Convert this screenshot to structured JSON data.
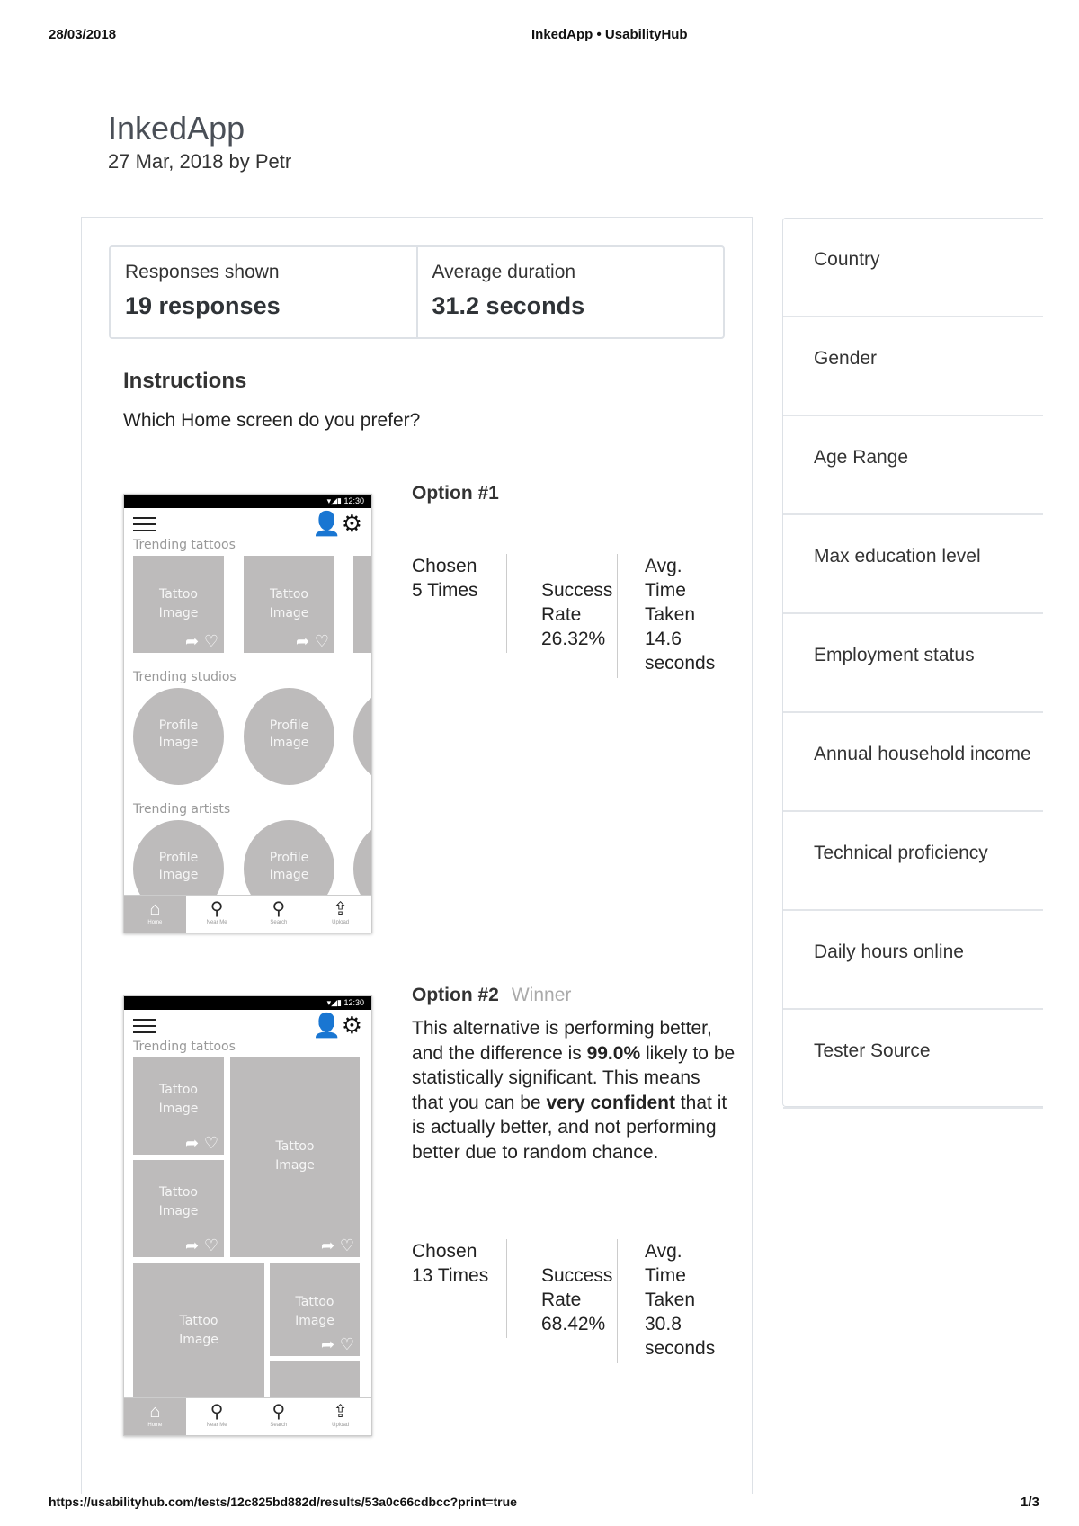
{
  "print_header": {
    "date": "28/03/2018",
    "title": "InkedApp • UsabilityHub"
  },
  "print_footer": {
    "url": "https://usabilityhub.com/tests/12c825bd882d/results/53a0c66cdbcc?print=true",
    "page": "1/3"
  },
  "test": {
    "title": "InkedApp",
    "subtitle": "27 Mar, 2018 by Petr"
  },
  "stats": {
    "responses_label": "Responses shown",
    "responses_value": "19 responses",
    "duration_label": "Average duration",
    "duration_value": "31.2 seconds"
  },
  "instructions": {
    "heading": "Instructions",
    "text": "Which Home screen do you prefer?"
  },
  "phone": {
    "time": "12:30",
    "trending_tattoos": "Trending tattoos",
    "trending_studios": "Trending studios",
    "trending_artists": "Trending artists",
    "tattoo_line1": "Tattoo",
    "tattoo_line2": "Image",
    "profile_line1": "Profile",
    "profile_line2": "Image",
    "nav": [
      "Home",
      "Near Me",
      "Search",
      "Upload"
    ]
  },
  "option1": {
    "title": "Option #1",
    "chosen_l1": "Chosen",
    "chosen_l2": "5 Times",
    "success_l1": "Success",
    "success_l2": "Rate",
    "success_l3": "26.32%",
    "avg_l1": "Avg.",
    "avg_l2": "Time",
    "avg_l3": "Taken",
    "avg_l4": "14.6",
    "avg_l5": "seconds"
  },
  "option2": {
    "title": "Option #2",
    "winner": "Winner",
    "desc_p1": "This alternative is performing better, and the difference is ",
    "desc_b1": "99.0%",
    "desc_p2": " likely to be statistically significant. This means that you can be ",
    "desc_b2": "very confident",
    "desc_p3": " that it is actually better, and not performing better due to random chance.",
    "chosen_l1": "Chosen",
    "chosen_l2": "13 Times",
    "success_l1": "Success",
    "success_l2": "Rate",
    "success_l3": "68.42%",
    "avg_l1": "Avg.",
    "avg_l2": "Time",
    "avg_l3": "Taken",
    "avg_l4": "30.8",
    "avg_l5": "seconds"
  },
  "filters": [
    "Country",
    "Gender",
    "Age Range",
    "Max education level",
    "Employment status",
    "Annual household income",
    "Technical proficiency",
    "Daily hours online",
    "Tester Source"
  ]
}
